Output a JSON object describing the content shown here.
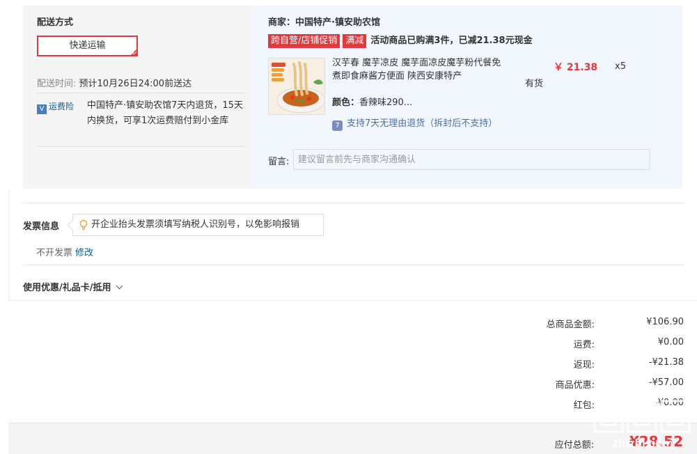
{
  "shipping": {
    "title": "配送方式",
    "method_label": "快递运输",
    "delivery_time_label": "配送时间:",
    "delivery_time_value": "预计10月26日24:00前送达",
    "insurance_tag": "运费险",
    "insurance_text": "中国特产·镇安助农馆7天内退货，15天内换货，可享1次运费赔付到小金库"
  },
  "order": {
    "merchant": "商家：中国特产·镇安助农馆",
    "promo_tags": [
      "跨自营/店铺促销",
      "满减"
    ],
    "promo_text": "活动商品已购满3件，已减21.38元现金",
    "product": {
      "name": "汉芋春 魔芋凉皮 魔芋面凉皮魔芋粉代餐免煮即食麻酱方便面 陕西安康特产",
      "price": "￥ 21.38",
      "quantity": "x5",
      "stock": "有货",
      "color_label": "颜色：",
      "color_value": "香辣味290...",
      "return_policy": "支持7天无理由退货（拆封后不支持）"
    },
    "message_label": "留言:",
    "message_placeholder": "建议留言前先与商家沟通确认"
  },
  "invoice": {
    "title": "发票信息",
    "tip": "开企业抬头发票须填写纳税人识别号，以免影响报销",
    "status": "不开发票",
    "edit_label": "修改"
  },
  "coupon": {
    "label": "使用优惠/礼品卡/抵用"
  },
  "summary": {
    "rows": [
      {
        "label": "总商品金额:",
        "value": "¥106.90"
      },
      {
        "label": "运费:",
        "value": "¥0.00"
      },
      {
        "label": "返现:",
        "value": "-¥21.38"
      },
      {
        "label": "商品优惠:",
        "value": "-¥57.00"
      },
      {
        "label": "红包:",
        "value": "-¥0.00"
      }
    ],
    "payable_label": "应付总额:",
    "payable_value": "¥28.52"
  },
  "watermark": {
    "text": "zhizhi.com",
    "logo": "值"
  },
  "colors": {
    "accent": "#e4393c",
    "link": "#005ea7",
    "panel_bg": "#f5f5f5",
    "order_bg": "#f2f7fd"
  }
}
